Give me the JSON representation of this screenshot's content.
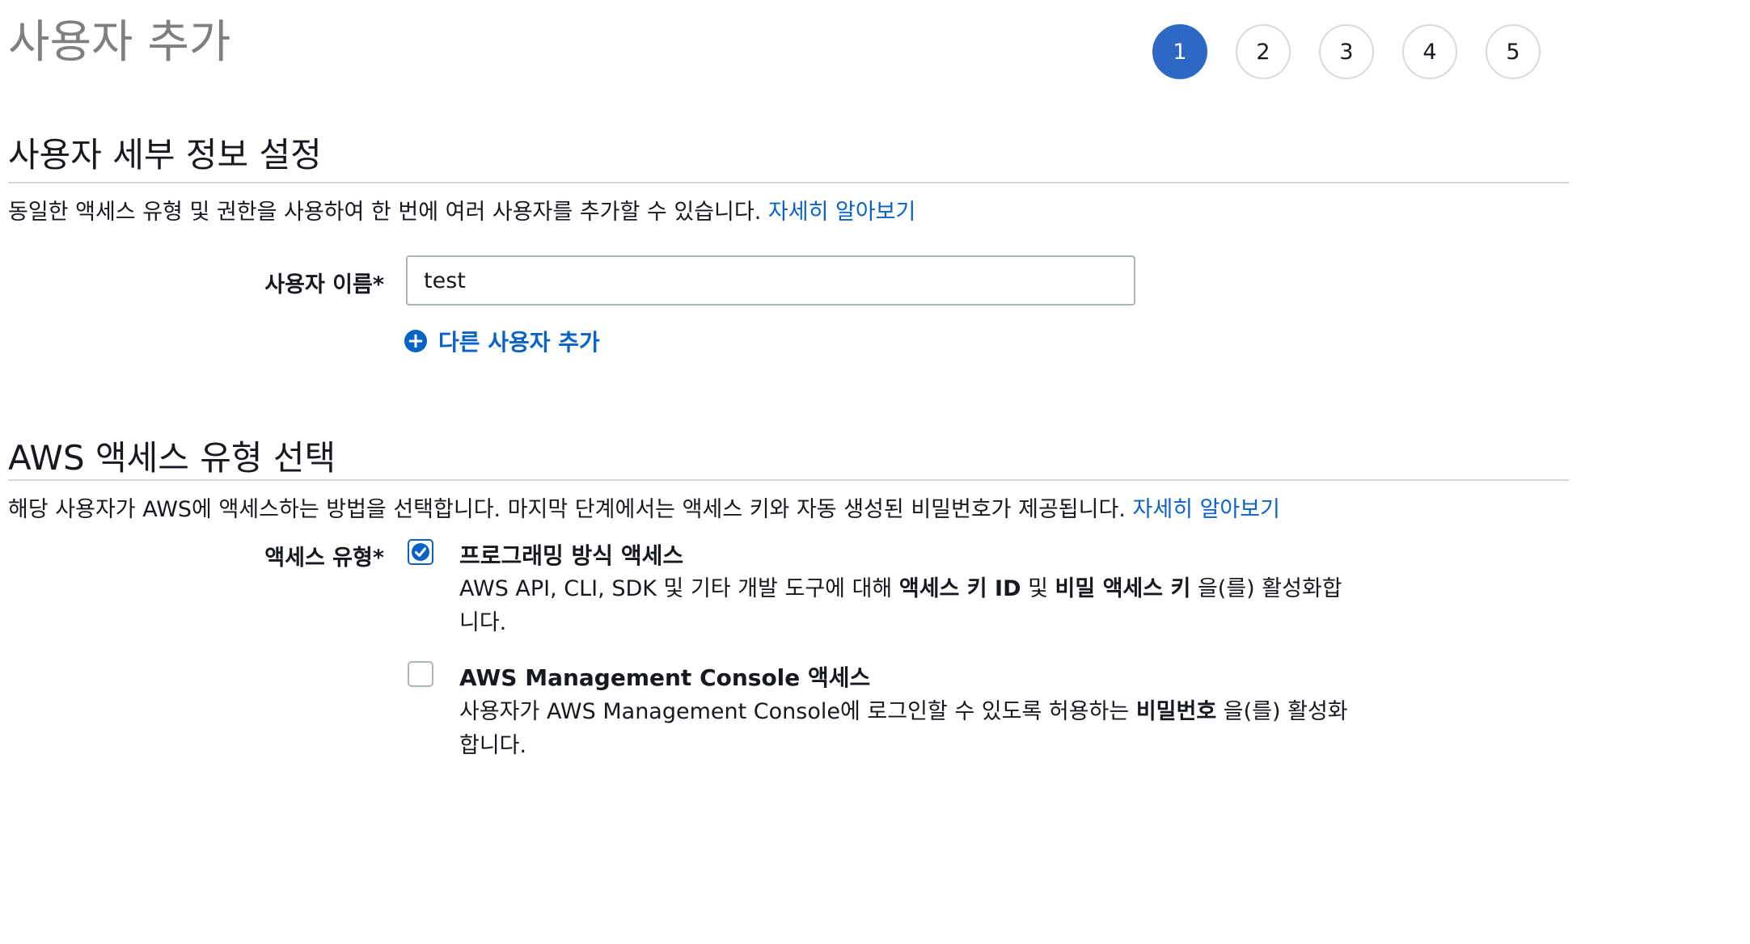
{
  "page": {
    "title": "사용자 추가"
  },
  "steps": [
    "1",
    "2",
    "3",
    "4",
    "5"
  ],
  "active_step": "1",
  "colors": {
    "accent": "#2d69c4",
    "link": "#0a62c7",
    "divider": "#d5dbdb"
  },
  "details": {
    "title": "사용자 세부 정보 설정",
    "description": "동일한 액세스 유형 및 권한을 사용하여 한 번에 여러 사용자를 추가할 수 있습니다.",
    "learn_more": "자세히 알아보기",
    "username_label": "사용자 이름*",
    "username_value": "test",
    "add_user_label": "다른 사용자 추가",
    "add_icon": "plus-circle-icon"
  },
  "access": {
    "title": "AWS 액세스 유형 선택",
    "description": "해당 사용자가 AWS에 액세스하는 방법을 선택합니다. 마지막 단계에서는 액세스 키와 자동 생성된 비밀번호가 제공됩니다.",
    "learn_more": "자세히 알아보기",
    "type_label": "액세스 유형*",
    "options": [
      {
        "title": "프로그래밍 방식 액세스",
        "checked": true,
        "desc_pre": "AWS API, CLI, SDK 및 기타 개발 도구에 대해",
        "desc_bold1": "액세스 키 ID",
        "desc_mid": "및",
        "desc_bold2": "비밀 액세스 키",
        "desc_post": "을(를) 활성화합니다."
      },
      {
        "title": "AWS Management Console 액세스",
        "checked": false,
        "desc_pre": "사용자가 AWS Management Console에 로그인할 수 있도록 허용하는",
        "desc_bold1": "비밀번호",
        "desc_post": "을(를) 활성화합니다."
      }
    ]
  }
}
